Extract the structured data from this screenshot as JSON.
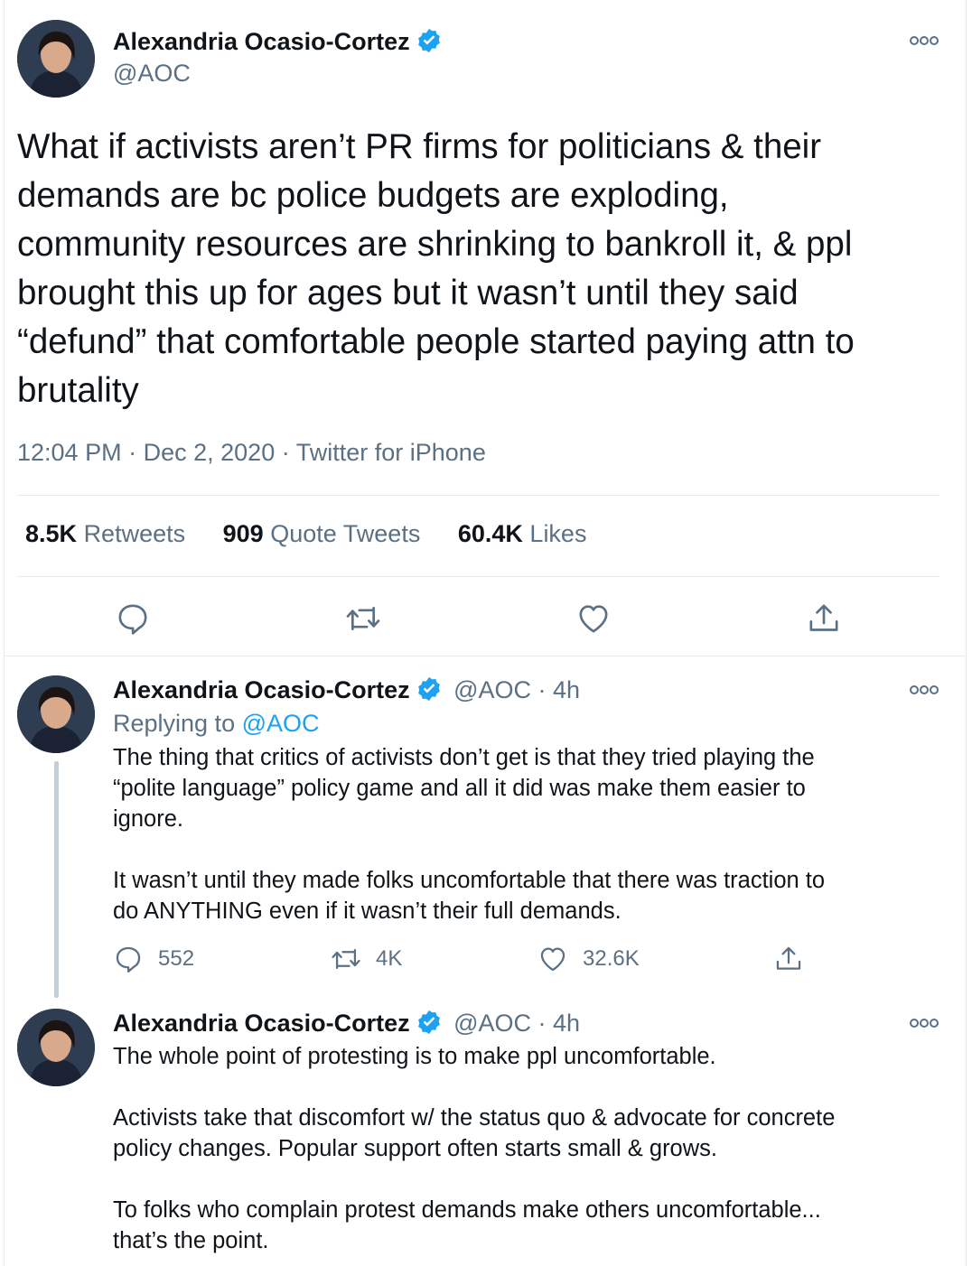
{
  "main_tweet": {
    "author_name": "Alexandria Ocasio-Cortez",
    "handle": "@AOC",
    "text": "What if activists aren’t PR firms for politicians & their\ndemands are bc police budgets are exploding,\ncommunity resources are shrinking to bankroll it, & ppl\nbrought this up for ages but it wasn’t until they said\n“defund” that comfortable people started paying attn to\nbrutality",
    "time": "12:04 PM",
    "date": "Dec 2, 2020",
    "source": "Twitter for iPhone",
    "separator": "·",
    "stats": {
      "retweets_count": "8.5K",
      "retweets_label": "Retweets",
      "quotes_count": "909",
      "quotes_label": "Quote Tweets",
      "likes_count": "60.4K",
      "likes_label": "Likes"
    }
  },
  "reply_1": {
    "author_name": "Alexandria Ocasio-Cortez",
    "handle_time": "@AOC · 4h",
    "replying_prefix": "Replying to",
    "replying_handle": "@AOC",
    "text": "The thing that critics of activists don’t get is that they tried playing the\n“polite language” policy game and all it did was make them easier to\nignore.\n\nIt wasn’t until they made folks uncomfortable that there was traction to\ndo ANYTHING even if it wasn’t their full demands.",
    "replies": "552",
    "retweets": "4K",
    "likes": "32.6K"
  },
  "reply_2": {
    "author_name": "Alexandria Ocasio-Cortez",
    "handle_time": "@AOC · 4h",
    "text": "The whole point of protesting is to make ppl uncomfortable.\n\nActivists take that discomfort w/ the status quo & advocate for concrete\npolicy changes. Popular support often starts small & grows.\n\nTo folks who complain protest demands make others uncomfortable...\nthat’s the point."
  },
  "icons": {
    "verified": "verified-badge-icon",
    "more": "more-options-icon",
    "reply": "reply-icon",
    "retweet": "retweet-icon",
    "like": "like-icon",
    "share": "share-icon"
  },
  "colors": {
    "text": "#0f1419",
    "secondary": "#5b7083",
    "accent": "#1da1f2",
    "divider": "#e6ecf0"
  }
}
